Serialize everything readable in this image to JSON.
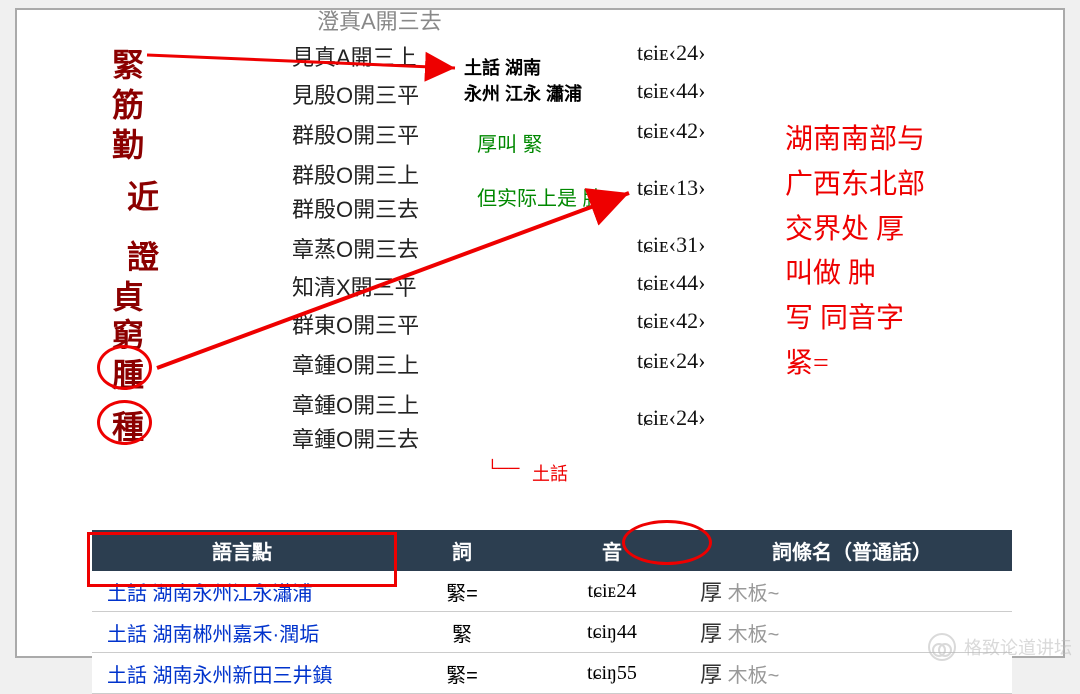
{
  "left_chars": {
    "truncated_top": "澄真A開三去",
    "c0": "緊",
    "c1": "筋",
    "c2": "勤",
    "c3": "近",
    "c4": "證",
    "c5": "貞",
    "c6": "窮",
    "c7": "腫",
    "c8": "種"
  },
  "mid": {
    "r0": "見真A開三上",
    "r1": "見殷O開三平",
    "r2": "群殷O開三平",
    "r3": "群殷O開三上",
    "r4": "群殷O開三去",
    "r5": "章蒸O開三去",
    "r6": "知清X開三平",
    "r7": "群東O開三平",
    "r8": "章鍾O開三上",
    "r9": "章鍾O開三上",
    "r10": "章鍾O開三去"
  },
  "ipa": {
    "r0": "tɕiᴇ‹24›",
    "r1": "tɕiᴇ‹44›",
    "r2": "tɕiᴇ‹42›",
    "r3_4": "tɕiᴇ‹13›",
    "r5": "tɕiᴇ‹31›",
    "r6": "tɕiᴇ‹44›",
    "r7": "tɕiᴇ‹42›",
    "r8": "tɕiᴇ‹24›",
    "r9_10": "tɕiᴇ‹24›"
  },
  "anno": {
    "box_line1": "土話 湖南",
    "box_line2": "永州   江永   瀟浦",
    "green1": "厚叫 緊",
    "green2": "但实际上是 肿",
    "bracket_label": "土話"
  },
  "right_box": {
    "l1": "湖南南部与",
    "l2": "广西东北部",
    "l3": "交界处  厚",
    "l4": "叫做  肿",
    "l5": "写  同音字",
    "l6": "紧="
  },
  "table": {
    "headers": {
      "c1": "語言點",
      "c2": "詞",
      "c3": "音",
      "c4": "詞條名（普通話）"
    },
    "rows": [
      {
        "dialect": "土話 湖南永州江永瀟浦",
        "word": "緊=",
        "sound": "tɕiᴇ24",
        "entry_big": "厚",
        "entry_small": "木板~"
      },
      {
        "dialect": "土話 湖南郴州嘉禾·潤垢",
        "word": "緊",
        "sound": "tɕiŋ44",
        "entry_big": "厚",
        "entry_small": "木板~"
      },
      {
        "dialect": "土話 湖南永州新田三井鎮",
        "word": "緊=",
        "sound": "tɕiŋ55",
        "entry_big": "厚",
        "entry_small": "木板~"
      }
    ]
  },
  "watermark": "格致论道讲坛"
}
